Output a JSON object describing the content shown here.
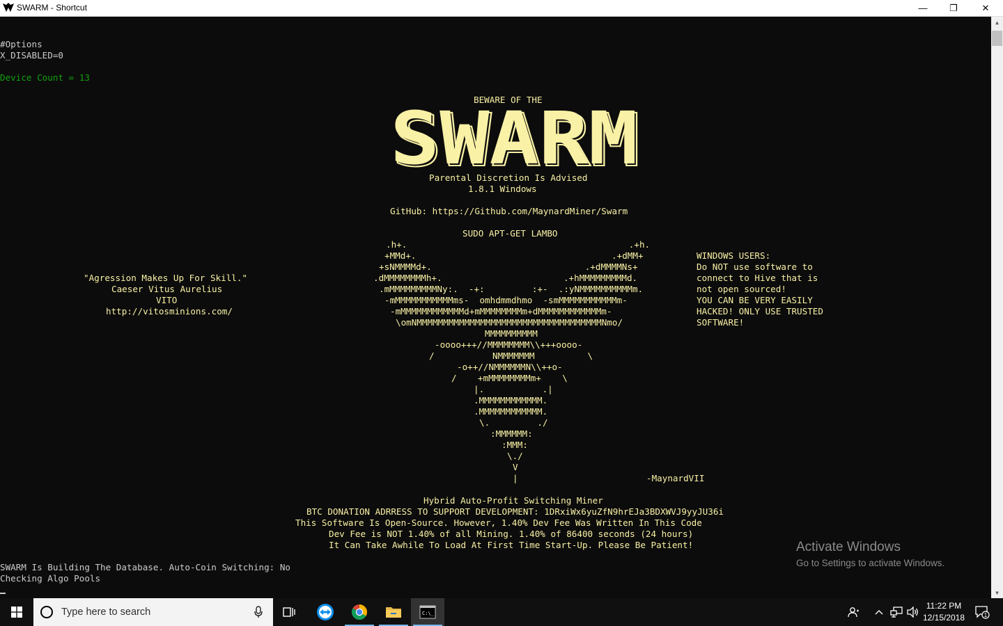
{
  "window": {
    "title": "SWARM - Shortcut",
    "minimize_glyph": "—",
    "restore_glyph": "❐",
    "close_glyph": "✕"
  },
  "console": {
    "lines": [
      {
        "text": "#Options",
        "color": "white"
      },
      {
        "text": "X_DISABLED=0",
        "color": "white"
      },
      {
        "text": "Device Count = 13",
        "color": "green"
      },
      {
        "text": "BEWARE OF THE",
        "color": "yellow"
      },
      {
        "text": "Parental Discretion Is Advised",
        "color": "yellow"
      },
      {
        "text": "1.8.1 Windows",
        "color": "yellow"
      },
      {
        "text": "GitHub: https://Github.com/MaynardMiner/Swarm",
        "color": "yellow"
      },
      {
        "text": "SUDO APT-GET LAMBO",
        "color": "yellow"
      },
      {
        "text": ".h+.                                          .+h.",
        "color": "yellow"
      },
      {
        "text": "+MMd+.                                     .+dMM+",
        "color": "yellow"
      },
      {
        "text": "+sNMMMMd+.                             .+dMMMMNs+",
        "color": "yellow"
      },
      {
        "text": ".dMMMMMMMMh+.                       .+hMMMMMMMMMd.",
        "color": "yellow"
      },
      {
        "text": ".mMMMMMMMMMNy:.  -+:         :+-  .:yNMMMMMMMMMMm.",
        "color": "yellow"
      },
      {
        "text": "-mMMMMMMMMMMMms-  omhdmmdhmo  -smMMMMMMMMMMMm-",
        "color": "yellow"
      },
      {
        "text": "-mMMMMMMMMMMMMd+mMMMMMMMMm+dMMMMMMMMMMMMm-",
        "color": "yellow"
      },
      {
        "text": "\\omNMMMMMMMMMMMMMMMMMMMMMMMMMMMMMMMMMMMNmo/",
        "color": "yellow"
      },
      {
        "text": "MMMMMMMMMM",
        "color": "yellow"
      },
      {
        "text": "-oooo+++//MMMMMMMM\\\\+++oooo-",
        "color": "yellow"
      },
      {
        "text": "/           NMMMMMMM          \\",
        "color": "yellow"
      },
      {
        "text": "-o++//NMMMMMMN\\\\++o-",
        "color": "yellow"
      },
      {
        "text": "/    +mMMMMMMMMm+    \\",
        "color": "yellow"
      },
      {
        "text": "|.           .|",
        "color": "yellow"
      },
      {
        "text": ".MMMMMMMMMMMM.",
        "color": "yellow"
      },
      {
        "text": ".MMMMMMMMMMMM.",
        "color": "yellow"
      },
      {
        "text": "\\.         ./",
        "color": "yellow"
      },
      {
        "text": ":MMMMMM:",
        "color": "yellow"
      },
      {
        "text": ":MMM:",
        "color": "yellow"
      },
      {
        "text": "\\./",
        "color": "yellow"
      },
      {
        "text": "V",
        "color": "yellow"
      },
      {
        "text": "|",
        "color": "yellow"
      },
      {
        "text": "-MaynardVII",
        "color": "yellow"
      },
      {
        "text": "\"Agression Makes Up For Skill.\"",
        "color": "yellow"
      },
      {
        "text": "Caeser Vitus Aurelius",
        "color": "yellow"
      },
      {
        "text": "VITO",
        "color": "yellow"
      },
      {
        "text": "http://vitosminions.com/",
        "color": "yellow"
      },
      {
        "text": "WINDOWS USERS:",
        "color": "yellow"
      },
      {
        "text": "Do NOT use software to",
        "color": "yellow"
      },
      {
        "text": "connect to Hive that is",
        "color": "yellow"
      },
      {
        "text": "not open sourced!",
        "color": "yellow"
      },
      {
        "text": "YOU CAN BE VERY EASILY",
        "color": "yellow"
      },
      {
        "text": "HACKED! ONLY USE TRUSTED",
        "color": "yellow"
      },
      {
        "text": "SOFTWARE!",
        "color": "yellow"
      },
      {
        "text": "Hybrid Auto-Profit Switching Miner",
        "color": "yellow"
      },
      {
        "text": "BTC DONATION ADRRESS TO SUPPORT DEVELOPMENT: 1DRxiWx6yuZfN9hrEJa3BDXWVJ9yyJU36i",
        "color": "yellow"
      },
      {
        "text": "This Software Is Open-Source. However, 1.40% Dev Fee Was Written In This Code",
        "color": "yellow"
      },
      {
        "text": "Dev Fee is NOT 1.40% of all Mining. 1.40% of 86400 seconds (24 hours)",
        "color": "yellow"
      },
      {
        "text": "It Can Take Awhile To Load At First Time Start-Up. Please Be Patient!",
        "color": "yellow"
      },
      {
        "text": "SWARM Is Building The Database. Auto-Coin Switching: No",
        "color": "white"
      },
      {
        "text": "Checking Algo Pools",
        "color": "white"
      }
    ],
    "logo_text": "SWARM",
    "colors": {
      "white": "#cccccc",
      "green": "#13a10e",
      "yellow": "#f9f1a5",
      "background": "#0c0c0c"
    }
  },
  "watermark": {
    "title": "Activate Windows",
    "subtitle": "Go to Settings to activate Windows."
  },
  "taskbar": {
    "search_placeholder": "Type here to search",
    "pinned": [
      {
        "name": "task-view-icon"
      },
      {
        "name": "teamviewer-icon"
      },
      {
        "name": "chrome-icon"
      },
      {
        "name": "file-explorer-icon"
      },
      {
        "name": "command-prompt-icon",
        "active": true
      }
    ],
    "tray_icons": [
      "people-icon",
      "chevron-up-icon",
      "network-icon",
      "volume-icon"
    ],
    "time": "11:22 PM",
    "date": "12/15/2018",
    "notifications_count": "1"
  }
}
